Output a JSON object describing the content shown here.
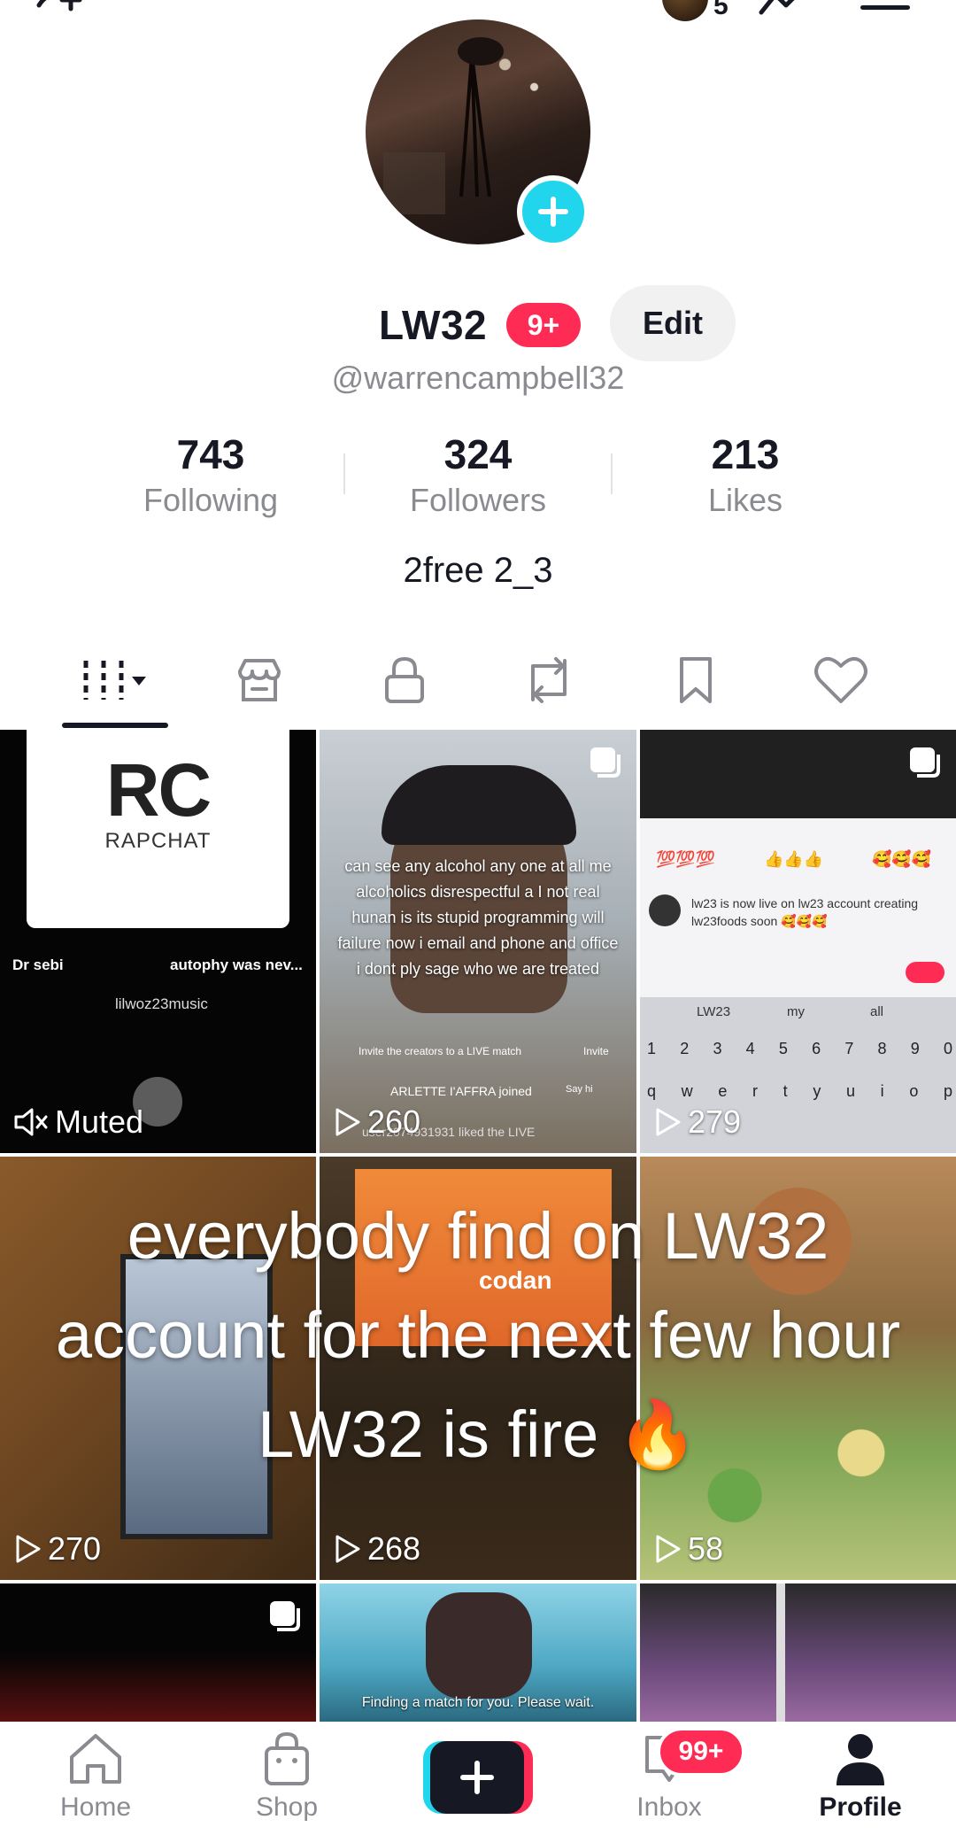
{
  "top_bar": {
    "notification_count": "5"
  },
  "profile": {
    "display_name": "LW32",
    "name_badge": "9+",
    "edit_label": "Edit",
    "handle": "@warrencampbell32",
    "bio": "2free 2_3"
  },
  "stats": [
    {
      "value": "743",
      "label": "Following"
    },
    {
      "value": "324",
      "label": "Followers"
    },
    {
      "value": "213",
      "label": "Likes"
    }
  ],
  "tabs": [
    {
      "icon": "videos-grid-icon",
      "active": true
    },
    {
      "icon": "shop-icon"
    },
    {
      "icon": "lock-icon"
    },
    {
      "icon": "repost-icon"
    },
    {
      "icon": "bookmark-icon"
    },
    {
      "icon": "heart-icon"
    }
  ],
  "videos": [
    {
      "status": "Muted",
      "thumb_text": {
        "brand_top": "RC",
        "brand_name": "RAPCHAT",
        "left_label": "Dr sebi",
        "right_label": "autophy was nev...",
        "artist": "lilwoz23music"
      }
    },
    {
      "views": "260",
      "thumb_text": {
        "caption": "can see any alcohol any one at all me alcoholics disrespectful a I not real hunan is its stupid programming will failure now i email and phone and office i dont ply sage who we are treated",
        "invite": "Invite the creators to a LIVE match",
        "invite_btn": "Invite",
        "joined": "ARLETTE I'AFFRA joined",
        "say_hi": "Say hi",
        "liked": "user2074931931 liked the LIVE"
      }
    },
    {
      "views": "279",
      "thumb_text": {
        "emoji_row": [
          "💯💯💯",
          "👍👍👍",
          "🥰🥰🥰"
        ],
        "comment": "lw23 is now live on lw23 account creating lw23foods soon 🥰🥰🥰",
        "suggest": [
          "LW23",
          "my",
          "all"
        ],
        "keys_row1": [
          "1",
          "2",
          "3",
          "4",
          "5",
          "6",
          "7",
          "8",
          "9",
          "0"
        ],
        "keys_row2": [
          "q",
          "w",
          "e",
          "r",
          "t",
          "y",
          "u",
          "i",
          "o",
          "p"
        ]
      }
    },
    {
      "views": "270"
    },
    {
      "views": "268",
      "thumb_text": {
        "screen": "codan"
      }
    },
    {
      "views": "58"
    },
    {},
    {
      "thumb_text": {
        "caption": "Finding a match for you. Please wait."
      }
    },
    {}
  ],
  "overlay_caption": "everybody find on LW32 account for the next few hour LW32 is fire 🔥",
  "bottom_nav": {
    "home": "Home",
    "shop": "Shop",
    "inbox": "Inbox",
    "inbox_badge": "99+",
    "profile": "Profile"
  },
  "colors": {
    "accent": "#fe2c55",
    "cyan": "#20d5ec",
    "text": "#161823",
    "muted": "#8a8b91"
  }
}
